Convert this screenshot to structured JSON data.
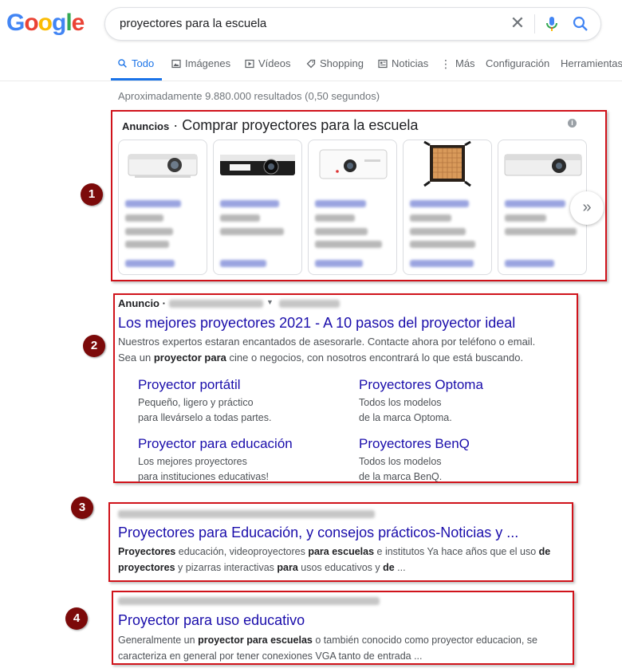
{
  "search": {
    "query": "proyectores para la escuela"
  },
  "tabs": [
    {
      "label": "Todo",
      "icon": "search-icon",
      "active": true
    },
    {
      "label": "Imágenes",
      "icon": "image-icon"
    },
    {
      "label": "Vídeos",
      "icon": "play-icon"
    },
    {
      "label": "Shopping",
      "icon": "tag-icon"
    },
    {
      "label": "Noticias",
      "icon": "news-icon"
    },
    {
      "label": "Más",
      "icon": "more-icon"
    },
    {
      "label": "Configuración"
    },
    {
      "label": "Herramientas"
    }
  ],
  "result_stats": "Aproximadamente 9.880.000 resultados (0,50 segundos)",
  "logo_text": "Google",
  "shopping_ads": {
    "label": "Anuncios",
    "separator": " · ",
    "title": "Comprar proyectores para la escuela",
    "marker": "1",
    "products": [
      {
        "image": "projector-white-benq"
      },
      {
        "image": "projector-black-epson"
      },
      {
        "image": "projector-white-epson"
      },
      {
        "image": "led-panel-light"
      },
      {
        "image": "projector-white-epson-2"
      }
    ]
  },
  "text_ad": {
    "marker": "2",
    "label": "Anuncio ·",
    "title": "Los mejores proyectores 2021 - A 10 pasos del proyector ideal",
    "description_parts": [
      {
        "text": "Nuestros expertos estaran encantados de asesorarle. Contacte ahora por teléfono o email. Sea un ",
        "bold": false
      },
      {
        "text": "proyector para",
        "bold": true
      },
      {
        "text": " cine o negocios, con nosotros encontrará lo que está buscando.",
        "bold": false
      }
    ],
    "sitelinks": [
      {
        "title": "Proyector portátil",
        "line1": "Pequeño, ligero y práctico",
        "line2": "para llevárselo a todas partes."
      },
      {
        "title": "Proyectores Optoma",
        "line1": "Todos los modelos",
        "line2": "de la marca Optoma."
      },
      {
        "title": "Proyector para educación",
        "line1": "Los mejores proyectores",
        "line2": "para instituciones educativas!"
      },
      {
        "title": "Proyectores BenQ",
        "line1": "Todos los modelos",
        "line2": "de la marca BenQ."
      }
    ]
  },
  "results": [
    {
      "marker": "3",
      "title": "Proyectores para Educación, y consejos prácticos-Noticias y ...",
      "description_parts": [
        {
          "text": "Proyectores",
          "bold": true
        },
        {
          "text": " educación, videoproyectores ",
          "bold": false
        },
        {
          "text": "para escuelas",
          "bold": true
        },
        {
          "text": " e institutos Ya hace años que el uso ",
          "bold": false
        },
        {
          "text": "de proyectores",
          "bold": true
        },
        {
          "text": " y pizarras interactivas ",
          "bold": false
        },
        {
          "text": "para",
          "bold": true
        },
        {
          "text": " usos educativos y ",
          "bold": false
        },
        {
          "text": "de",
          "bold": true
        },
        {
          "text": " ...",
          "bold": false
        }
      ]
    },
    {
      "marker": "4",
      "title": "Proyector para uso educativo",
      "description_parts": [
        {
          "text": "Generalmente un ",
          "bold": false
        },
        {
          "text": "proyector para escuelas",
          "bold": true
        },
        {
          "text": " o también conocido como proyector educacion, se caracteriza en general por tener conexiones VGA tanto de entrada ...",
          "bold": false
        }
      ]
    }
  ],
  "colors": {
    "link": "#1a0dab",
    "accent": "#1a73e8",
    "highlight_box": "#d0131b",
    "marker": "#7c0a0a"
  }
}
